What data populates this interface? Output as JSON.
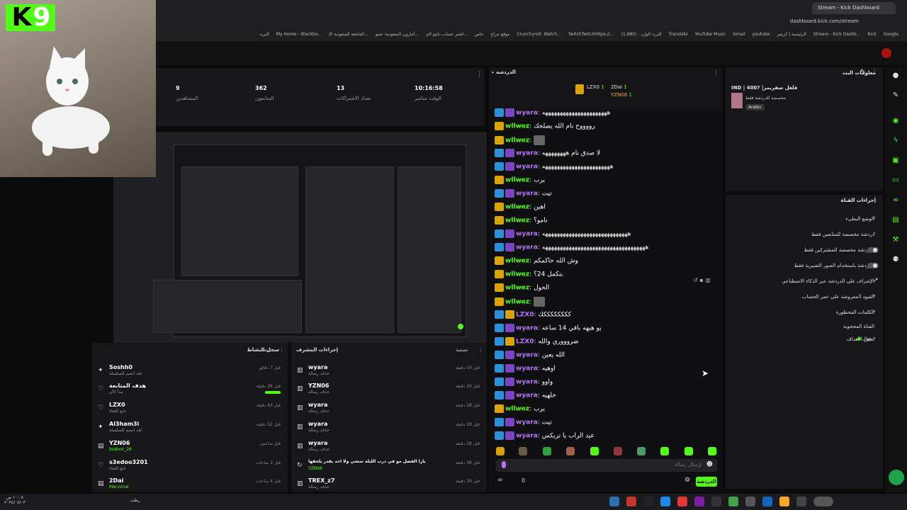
{
  "browser": {
    "tab_title": "Stream - Kick Dashboard",
    "url": "dashboard.kick.com/stream",
    "bookmarks": [
      "Google",
      "Kick",
      "Stream - Kick Dashb...",
      "الرئيسية | كريتير",
      "youtube",
      "Gmail",
      "YouTube Music",
      "Translate",
      "البريد الوارد - (1,985)",
      "TwitchTwitchhttps://...",
      "Crunchyroll: Watch...",
      "موقع حراج",
      "خاص",
      "اشتر حساب دايتو لاي...",
      "أمازون السعودية: تسو...",
      "الجامعة السعودية الإ...",
      "My Home – Blackbo...",
      "البريد"
    ]
  },
  "overlay": {
    "logo_letter": "K",
    "logo_number": "9"
  },
  "stats": [
    {
      "value": "10:16:58",
      "label": "الوقت مباشر"
    },
    {
      "value": "13",
      "label": "تعداد الاشتراكات"
    },
    {
      "value": "362",
      "label": "المتابعون"
    },
    {
      "value": "9",
      "label": "المشاهدين"
    }
  ],
  "activity_log": {
    "title": "سجل النشاط",
    "filter": "تصفية",
    "rows": [
      {
        "name": "Soshh0",
        "sub": "لقد انضم للسلسلة",
        "time": "قبل 7 دقائق",
        "icon": "gift"
      },
      {
        "name": "هدف المتابعة",
        "sub": "يبدأ الآن",
        "time": "قبل 28 دقيقة",
        "icon": "heart"
      },
      {
        "name": "LZX0",
        "sub": "تابع القناة",
        "time": "قبل 43 دقيقة",
        "icon": "heart"
      },
      {
        "name": "Al3ham3i",
        "sub": "لقد انضم للسلسلة",
        "time": "قبل 52 دقيقة",
        "icon": "gift"
      },
      {
        "name": "YZN06",
        "sub": "budoor_26",
        "time": "قبل ساعتين",
        "icon": "sub"
      },
      {
        "name": "s3edoo3201",
        "sub": "تابع القناة",
        "time": "قبل 3 ساعات",
        "icon": "heart"
      },
      {
        "name": "2Dai",
        "sub": "Marvonal",
        "time": "قبل 4 ساعات",
        "icon": "sub"
      }
    ]
  },
  "mod_actions": {
    "title": "إجراءات المشرف",
    "filter": "تصفية",
    "rows": [
      {
        "name": "wyara",
        "sub": "حذف رسالة",
        "time": "قبل 19 دقيقة"
      },
      {
        "name": "YZN06",
        "sub": "حذف رسالة",
        "time": "قبل 20 دقيقة"
      },
      {
        "name": "wyara",
        "sub": "حذف رسالة",
        "time": "قبل 28 دقيقة"
      },
      {
        "name": "wyara",
        "sub": "حذف رسالة",
        "time": "قبل 28 دقيقة"
      },
      {
        "name": "wyara",
        "sub": "حذف رسالة",
        "time": "قبل 28 دقيقة"
      },
      {
        "name": "يارا الفضل مو في درب الليله تمشي ولا احد يقدر يلحقها",
        "sub": "YZN06",
        "time": "قبل 38 دقيقة"
      },
      {
        "name": "TREX_z7",
        "sub": "حذف رسالة",
        "time": "قبل 39 دقيقة"
      }
    ]
  },
  "chat": {
    "title": "الدردشة",
    "leaderboard": [
      {
        "name": "LZX0",
        "count": "1"
      },
      {
        "name": "2Dai",
        "count": "1"
      },
      {
        "name": "YZN06",
        "count": "1"
      }
    ],
    "messages": [
      {
        "user": "wyara",
        "text": "ههههههههههههههههههههههه",
        "color": "#b476f5"
      },
      {
        "user": "wllwez",
        "text": "رووووح نام الله يصلحك",
        "color": "#53fc18"
      },
      {
        "user": "wllwez",
        "text": "",
        "color": "#53fc18"
      },
      {
        "user": "wyara",
        "text": "لا صدق نام ههههههههه",
        "color": "#b476f5"
      },
      {
        "user": "wyara",
        "text": "هههههههههههههههههههههههه",
        "color": "#b476f5"
      },
      {
        "user": "wllwez",
        "text": "يرب",
        "color": "#53fc18"
      },
      {
        "user": "wyara",
        "text": "تيت",
        "color": "#b476f5"
      },
      {
        "user": "wllwez",
        "text": "اهين",
        "color": "#53fc18"
      },
      {
        "user": "wllwez",
        "text": "نامو؟",
        "color": "#53fc18"
      },
      {
        "user": "wyara",
        "text": "هههههههههههههههههههههههههههههه",
        "color": "#b476f5"
      },
      {
        "user": "wyara",
        "text": "هههههههههههههههههههههههههههههههههههه",
        "color": "#b476f5"
      },
      {
        "user": "wllwez",
        "text": "وش الله حاكمكم",
        "color": "#53fc18"
      },
      {
        "user": "wllwez",
        "text": "بتكمل 24؟",
        "color": "#53fc18"
      },
      {
        "user": "wllwez",
        "text": "الحول",
        "color": "#53fc18"
      },
      {
        "user": "wllwez",
        "text": "",
        "color": "#53fc18"
      },
      {
        "user": "LZX0",
        "text": "ككككككككك",
        "color": "#b476f5"
      },
      {
        "user": "wyara",
        "text": "يو هيهه باقي 14 ساعه",
        "color": "#b476f5"
      },
      {
        "user": "LZX0",
        "text": "ضروووري والله",
        "color": "#b476f5"
      },
      {
        "user": "wyara",
        "text": "الله يعين",
        "color": "#b476f5"
      },
      {
        "user": "wyara",
        "text": "اوهيه",
        "color": "#b476f5"
      },
      {
        "user": "wyara",
        "text": "واوو",
        "color": "#b476f5"
      },
      {
        "user": "wyara",
        "text": "خلهيه",
        "color": "#b476f5"
      },
      {
        "user": "wllwez",
        "text": "يرب",
        "color": "#53fc18"
      },
      {
        "user": "wyara",
        "text": "تيت",
        "color": "#b476f5"
      },
      {
        "user": "wyara",
        "text": "عيد الراب يا تريكس",
        "color": "#b476f5"
      }
    ],
    "input_placeholder": "إرسال رسالة",
    "send_label": "الدردشة",
    "viewer_count": "0"
  },
  "stream_info": {
    "title": "معلومات البث",
    "stream_title": "IND | 400? |قلغل سفريمر",
    "category": "مخصصة للدردشة فقط",
    "language": "Arabic"
  },
  "channel_actions": {
    "title": "إجراءات القناة",
    "items": [
      {
        "label": "الوضع البطيء",
        "kind": "chevron"
      },
      {
        "label": "دردشة مخصصة للمتابعين فقط",
        "kind": "chevron"
      },
      {
        "label": "الدردشة مخصصة للمشتركين فقط",
        "kind": "toggle"
      },
      {
        "label": "الدردشة باستخدام الصور التعبيرية فقط",
        "kind": "toggle"
      },
      {
        "label": "الإشراف على الدردشة عبر الذكاء الاصطناعي",
        "kind": "link"
      },
      {
        "label": "القيود المفروضة على عمر الحساب",
        "kind": "chevron"
      },
      {
        "label": "الكلمات المحظورة",
        "kind": "chevron"
      },
      {
        "label": "القناة المحجوبة",
        "kind": "none"
      },
      {
        "label": "تعيين الأهداف",
        "kind": "chevron"
      }
    ],
    "goal_status": "فعال"
  },
  "taskbar": {
    "time": "١٠:٠٨ ص",
    "date": "٢٠٢٤/٠٧/٠٣",
    "weather": "رطب"
  }
}
